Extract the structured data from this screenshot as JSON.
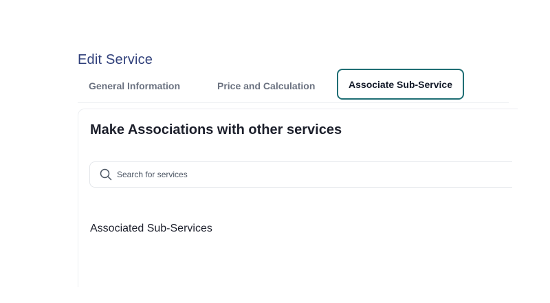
{
  "page": {
    "title": "Edit Service"
  },
  "tabs": [
    {
      "label": "General Information",
      "active": false
    },
    {
      "label": "Price and Calculation",
      "active": false
    },
    {
      "label": "Associate Sub-Service",
      "active": true
    }
  ],
  "main": {
    "heading": "Make Associations with other services",
    "search": {
      "placeholder": "Search for services",
      "icon": "search-icon"
    },
    "associated_label": "Associated Sub-Services"
  },
  "colors": {
    "title": "#2f3f7a",
    "active_tab_border": "#1f6e74"
  }
}
